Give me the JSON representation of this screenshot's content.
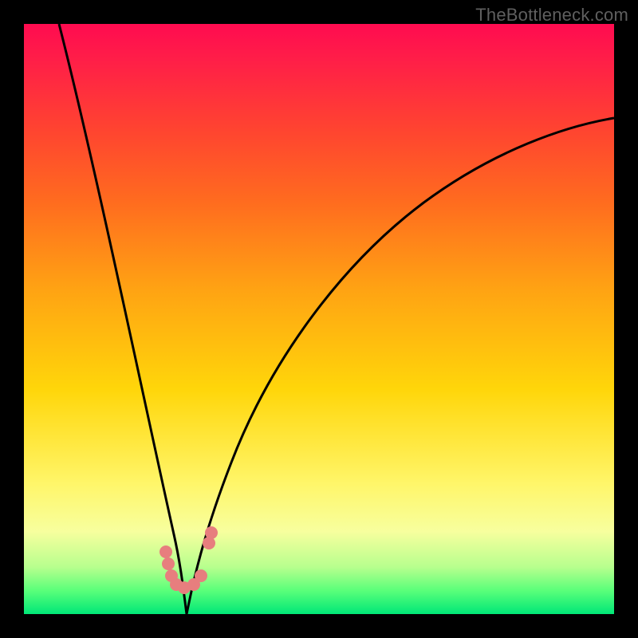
{
  "watermark": "TheBottleneck.com",
  "colors": {
    "background": "#000000",
    "curve_stroke": "#000000",
    "marker_fill": "#e77e7e",
    "gradient_top": "#ff0b50",
    "gradient_bottom": "#00e777"
  },
  "markers": [
    {
      "x": 0.24,
      "y": 0.895
    },
    {
      "x": 0.245,
      "y": 0.915
    },
    {
      "x": 0.25,
      "y": 0.935
    },
    {
      "x": 0.258,
      "y": 0.95
    },
    {
      "x": 0.272,
      "y": 0.955
    },
    {
      "x": 0.288,
      "y": 0.95
    },
    {
      "x": 0.3,
      "y": 0.935
    },
    {
      "x": 0.313,
      "y": 0.88
    },
    {
      "x": 0.318,
      "y": 0.862
    }
  ],
  "chart_data": {
    "type": "line",
    "title": "",
    "xlabel": "",
    "ylabel": "",
    "xlim": [
      0,
      1
    ],
    "ylim": [
      0,
      1
    ],
    "note": "x and y are normalized to the plot area (0..1, y=0 at top). Two curves meeting near x≈0.27, y≈1 (the green/bottom edge). Values read off the rendered pixels; the image has no axis ticks so units are unitless normalized coordinates.",
    "series": [
      {
        "name": "left-curve",
        "x": [
          0.06,
          0.09,
          0.12,
          0.15,
          0.18,
          0.21,
          0.23,
          0.25,
          0.265,
          0.275
        ],
        "y": [
          0.0,
          0.14,
          0.29,
          0.44,
          0.59,
          0.74,
          0.83,
          0.91,
          0.96,
          1.0
        ]
      },
      {
        "name": "right-curve",
        "x": [
          0.275,
          0.3,
          0.34,
          0.4,
          0.47,
          0.56,
          0.66,
          0.77,
          0.88,
          1.0
        ],
        "y": [
          1.0,
          0.88,
          0.76,
          0.63,
          0.51,
          0.4,
          0.31,
          0.24,
          0.19,
          0.16
        ]
      }
    ],
    "markers_description": "Cluster of salmon-colored dots near the trough where the two curves meet, roughly x∈[0.24,0.32], y∈[0.86,0.96]."
  }
}
